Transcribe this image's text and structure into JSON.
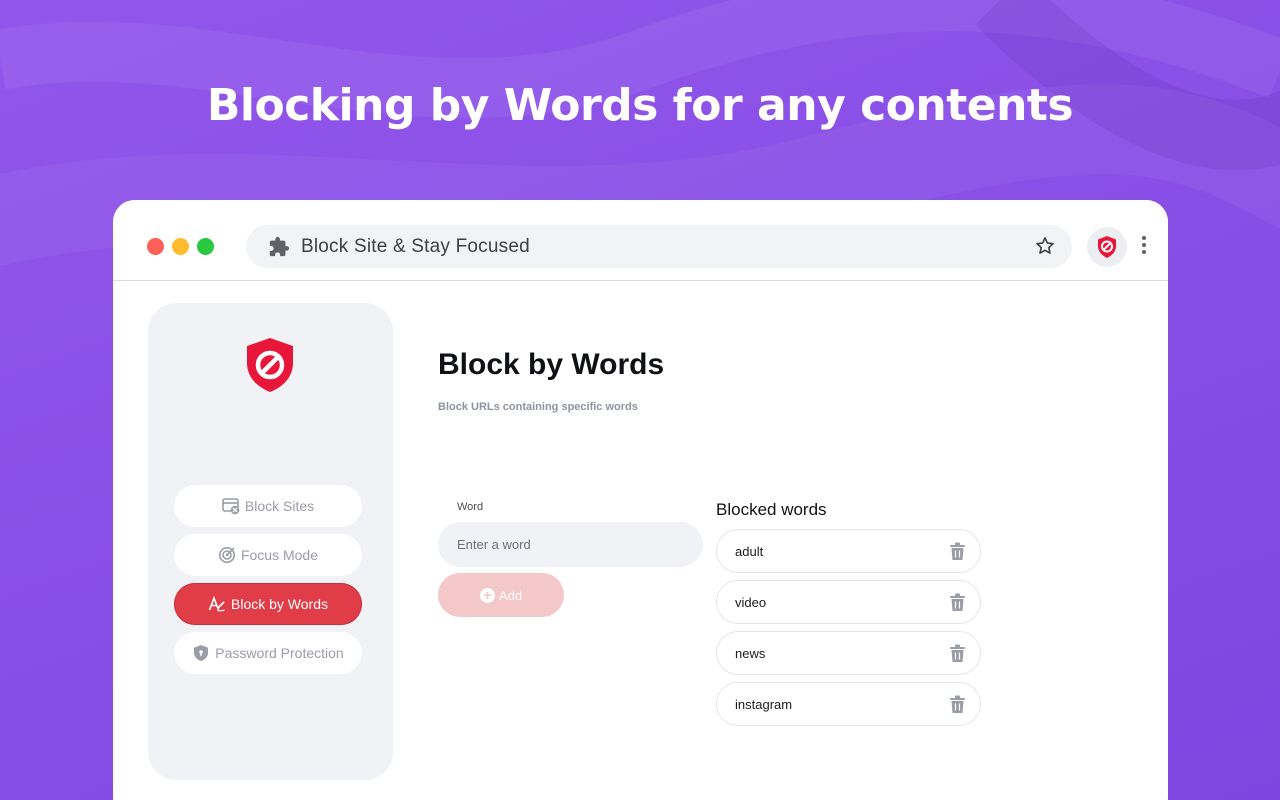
{
  "headline": "Blocking by Words for any contents",
  "browser": {
    "omnibox_text": "Block Site & Stay Focused"
  },
  "sidebar": {
    "items": [
      {
        "label": "Block Sites",
        "icon": "browser-block-icon",
        "active": false
      },
      {
        "label": "Focus Mode",
        "icon": "target-icon",
        "active": false
      },
      {
        "label": "Block by Words",
        "icon": "text-edit-icon",
        "active": true
      },
      {
        "label": "Password Protection",
        "icon": "shield-lock-icon",
        "active": false
      }
    ]
  },
  "main": {
    "title": "Block by Words",
    "subtitle": "Block URLs containing specific words",
    "word_label": "Word",
    "word_placeholder": "Enter a word",
    "add_label": "Add",
    "blocked_title": "Blocked words",
    "blocked_words": [
      "adult",
      "video",
      "news",
      "instagram"
    ]
  },
  "colors": {
    "background": "#8a4fe6",
    "accent_red": "#e03d48",
    "add_disabled": "#f4c7c9"
  }
}
